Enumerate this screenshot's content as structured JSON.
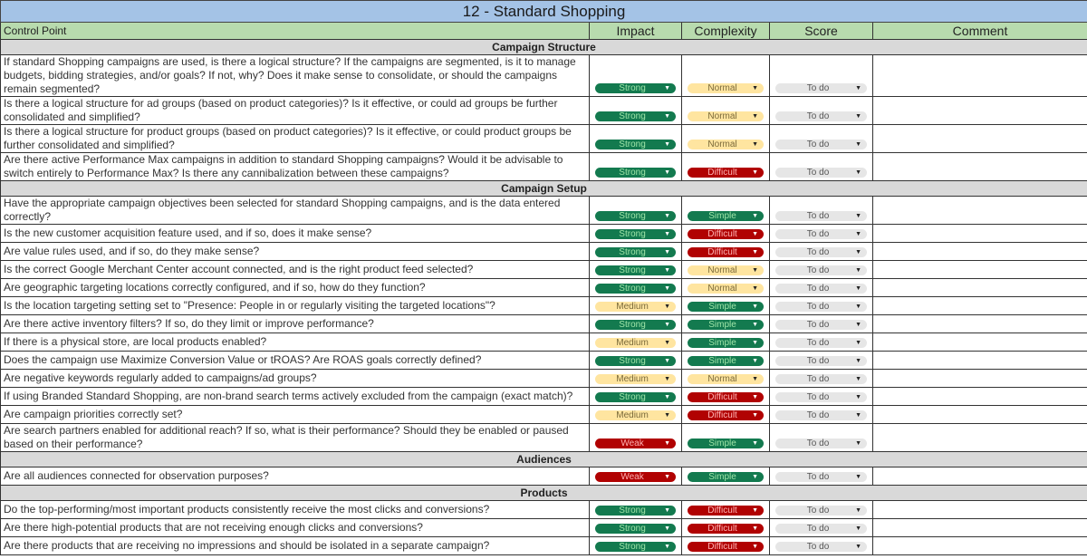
{
  "title": "12 - Standard Shopping",
  "headers": {
    "control_point": "Control Point",
    "impact": "Impact",
    "complexity": "Complexity",
    "score": "Score",
    "comment": "Comment"
  },
  "colors": {
    "title_bg": "#a4c3e6",
    "header_bg": "#b8dbae",
    "section_bg": "#d9d9d9",
    "green": "#137a4f",
    "red": "#b10202",
    "yellow": "#ffe5a0",
    "gray": "#e6e6e6"
  },
  "sections": [
    {
      "name": "Campaign Structure",
      "rows": [
        {
          "q": "If standard Shopping campaigns are used, is there a logical structure? If the campaigns are segmented, is it to manage budgets, bidding strategies, and/or goals? If not, why? Does it make sense to consolidate, or should the campaigns remain segmented?",
          "impact": "Strong",
          "complexity": "Normal",
          "score": "To do",
          "comment": ""
        },
        {
          "q": "Is there a logical structure for ad groups (based on product categories)? Is it effective, or could ad groups be further consolidated and simplified?",
          "impact": "Strong",
          "complexity": "Normal",
          "score": "To do",
          "comment": ""
        },
        {
          "q": "Is there a logical structure for product groups (based on product categories)? Is it effective, or could product groups be further consolidated and simplified?",
          "impact": "Strong",
          "complexity": "Normal",
          "score": "To do",
          "comment": ""
        },
        {
          "q": "Are there active Performance Max campaigns in addition to standard Shopping campaigns? Would it be advisable to switch entirely to Performance Max? Is there any cannibalization between these campaigns?",
          "impact": "Strong",
          "complexity": "Difficult",
          "score": "To do",
          "comment": ""
        }
      ]
    },
    {
      "name": "Campaign Setup",
      "rows": [
        {
          "q": "Have the appropriate campaign objectives been selected for standard Shopping campaigns, and is the data entered correctly?",
          "impact": "Strong",
          "complexity": "Simple",
          "score": "To do",
          "comment": ""
        },
        {
          "q": "Is the new customer acquisition feature used, and if so, does it make sense?",
          "impact": "Strong",
          "complexity": "Difficult",
          "score": "To do",
          "comment": ""
        },
        {
          "q": "Are value rules used, and if so, do they make sense?",
          "impact": "Strong",
          "complexity": "Difficult",
          "score": "To do",
          "comment": ""
        },
        {
          "q": "Is the correct Google Merchant Center account connected, and is the right product feed selected?",
          "impact": "Strong",
          "complexity": "Normal",
          "score": "To do",
          "comment": ""
        },
        {
          "q": "Are geographic targeting locations correctly configured, and if so, how do they function?",
          "impact": "Strong",
          "complexity": "Normal",
          "score": "To do",
          "comment": ""
        },
        {
          "q": "Is the location targeting setting set to \"Presence: People in or regularly visiting the targeted locations\"?",
          "impact": "Medium",
          "complexity": "Simple",
          "score": "To do",
          "comment": ""
        },
        {
          "q": "Are there active inventory filters? If so, do they limit or improve performance?",
          "impact": "Strong",
          "complexity": "Simple",
          "score": "To do",
          "comment": ""
        },
        {
          "q": "If there is a physical store, are local products enabled?",
          "impact": "Medium",
          "complexity": "Simple",
          "score": "To do",
          "comment": ""
        },
        {
          "q": "Does the campaign use Maximize Conversion Value or tROAS? Are ROAS goals correctly defined?",
          "impact": "Strong",
          "complexity": "Simple",
          "score": "To do",
          "comment": ""
        },
        {
          "q": "Are negative keywords regularly added to campaigns/ad groups?",
          "impact": "Medium",
          "complexity": "Normal",
          "score": "To do",
          "comment": ""
        },
        {
          "q": "If using Branded Standard Shopping, are non-brand search terms actively excluded from the campaign (exact match)?",
          "impact": "Strong",
          "complexity": "Difficult",
          "score": "To do",
          "comment": ""
        },
        {
          "q": "Are campaign priorities correctly set?",
          "impact": "Medium",
          "complexity": "Difficult",
          "score": "To do",
          "comment": ""
        },
        {
          "q": "Are search partners enabled for additional reach? If so, what is their performance? Should they be enabled or paused based on their performance?",
          "impact": "Weak",
          "complexity": "Simple",
          "score": "To do",
          "comment": ""
        }
      ]
    },
    {
      "name": "Audiences",
      "rows": [
        {
          "q": "Are all audiences connected for observation purposes?",
          "impact": "Weak",
          "complexity": "Simple",
          "score": "To do",
          "comment": ""
        }
      ]
    },
    {
      "name": "Products",
      "rows": [
        {
          "q": "Do the top-performing/most important products consistently receive the most clicks and conversions?",
          "impact": "Strong",
          "complexity": "Difficult",
          "score": "To do",
          "comment": ""
        },
        {
          "q": "Are there high-potential products that are not receiving enough clicks and conversions?",
          "impact": "Strong",
          "complexity": "Difficult",
          "score": "To do",
          "comment": ""
        },
        {
          "q": "Are there products that are receiving no impressions and should be isolated in a separate campaign?",
          "impact": "Strong",
          "complexity": "Difficult",
          "score": "To do",
          "comment": ""
        }
      ]
    }
  ]
}
